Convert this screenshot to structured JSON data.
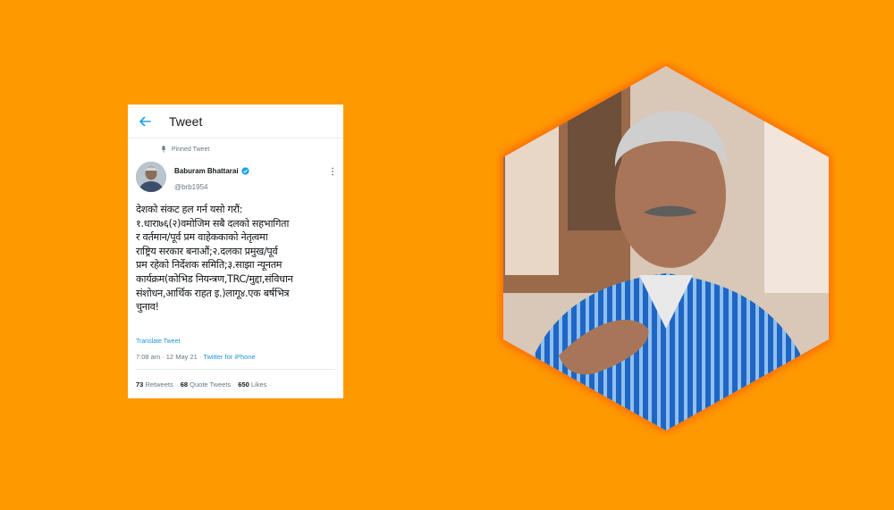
{
  "header": {
    "title": "Tweet"
  },
  "tweet": {
    "pinned_label": "Pinned Tweet",
    "author_name": "Baburam Bhattarai",
    "handle": "@brb1954",
    "text": "देशको संकट हल गर्न यसो गरौं:\n१.धारा७६(२)वमोजिम सबै दलको सहभागिता\nर वर्तमान/पूर्व प्रम वाहेककाको नेतृत्वमा\nराष्ट्रिय सरकार बनाऔं;२.दलका प्रमुख/पूर्व\nप्रम रहेको निर्देशक समिति;३.साझा न्यूनतम\nकार्यक्रम(कोभिड नियन्त्रण,TRC/मुद्दा,संविधान\nसंशोधन,आर्थिक राहत इ.)लागू४.एक बर्षभित्र\nचुनाव!",
    "translate_label": "Translate Tweet",
    "time": "7:08 am · 12 May 21 · ",
    "source": "Twitter for iPhone",
    "retweets_count": "73",
    "retweets_label": "Retweets",
    "quotes_count": "68",
    "quotes_label": "Quote Tweets",
    "likes_count": "650",
    "likes_label": "Likes"
  },
  "colors": {
    "background": "#ff9900",
    "link": "#1b95e0",
    "glow": "#ff6a00"
  },
  "icons": {
    "back": "arrow-left-icon",
    "pin": "pin-icon",
    "verified": "verified-badge-icon",
    "more": "more-vertical-icon"
  }
}
